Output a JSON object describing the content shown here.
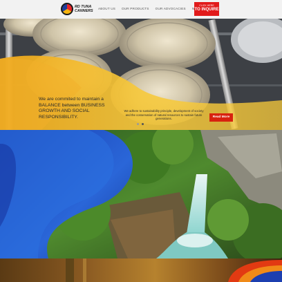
{
  "brand": {
    "line1": "RD TUNA",
    "line2": "CANNERS"
  },
  "nav": {
    "items": [
      "ABOUT US",
      "OUR PRODUCTS",
      "OUR ADVOCACIES",
      "NEWS & INFO"
    ]
  },
  "inquire": {
    "small": "CLICK HERE",
    "big": "TO INQUIRE"
  },
  "hero": {
    "headline": "We are commited to maintain a BALANCE between BUSINESS GROWTH AND SOCIAL RESPONSIBILITY.",
    "body": "We adhere to sustainability principle, development of society and the conservation of natural resources to sustain future generations.",
    "read_more": "Read More",
    "slides": 2,
    "active_slide": 2
  },
  "colors": {
    "accent_red": "#e11b1b",
    "accent_yellow": "#f5b40f",
    "accent_blue": "#1f4fc4"
  }
}
